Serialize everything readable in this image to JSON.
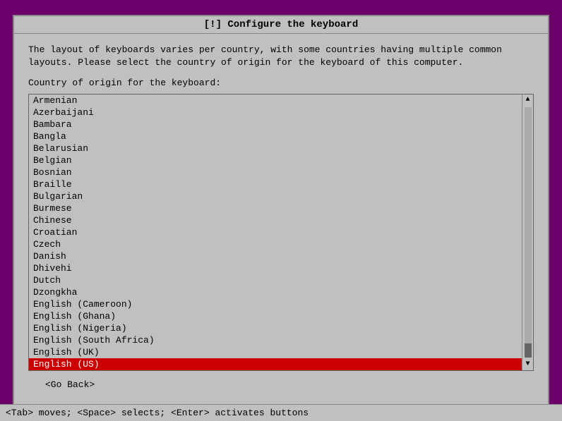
{
  "window": {
    "title": "[!] Configure the keyboard"
  },
  "description": {
    "line1": "The layout of keyboards varies per country, with some countries having multiple common",
    "line2": "layouts. Please select the country of origin for the keyboard of this computer."
  },
  "country_label": "Country of origin for the keyboard:",
  "list_items": [
    "Armenian",
    "Azerbaijani",
    "Bambara",
    "Bangla",
    "Belarusian",
    "Belgian",
    "Bosnian",
    "Braille",
    "Bulgarian",
    "Burmese",
    "Chinese",
    "Croatian",
    "Czech",
    "Danish",
    "Dhivehi",
    "Dutch",
    "Dzongkha",
    "English (Cameroon)",
    "English (Ghana)",
    "English (Nigeria)",
    "English (South Africa)",
    "English (UK)",
    "English (US)"
  ],
  "selected_item": "English (US)",
  "buttons": {
    "go_back": "<Go Back>"
  },
  "status_bar": "<Tab> moves; <Space> selects; <Enter> activates buttons"
}
